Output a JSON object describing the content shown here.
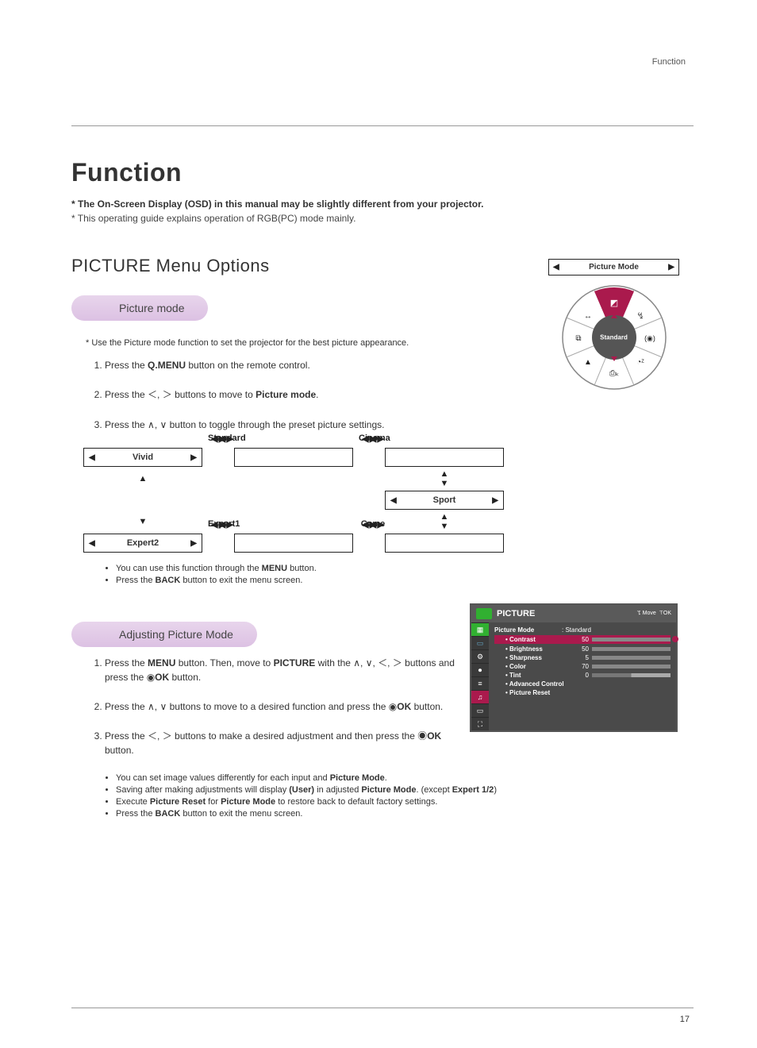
{
  "header": {
    "label": "Function"
  },
  "title": "Function",
  "intro_bold": "* The On-Screen Display (OSD) in this manual may be slightly different from your projector.",
  "intro_note": "* This operating guide explains operation of RGB(PC) mode mainly.",
  "section_title": "PICTURE Menu Options",
  "sub1": {
    "pill": "Picture mode",
    "note": "* Use the Picture mode function to set the projector for the best picture appearance.",
    "steps": {
      "s1a": "Press the ",
      "s1b": "Q.MENU",
      "s1c": " button on the remote control.",
      "s2a": "Press the ",
      "s2b": "＜",
      "s2c": ", ",
      "s2d": "＞",
      "s2e": " buttons to move to ",
      "s2f": "Picture mode",
      "s2g": ".",
      "s3a": "Press the ",
      "s3b": "∧",
      "s3c": ",   ",
      "s3d": "∨",
      "s3e": "  button to toggle through the preset picture settings."
    },
    "modes": {
      "vivid": "Vivid",
      "standard": "Standard",
      "cinema": "Cinema",
      "sport": "Sport",
      "game": "Game",
      "expert1": "Expert1",
      "expert2": "Expert2"
    },
    "bullets": {
      "b1a": "You can use this function through the ",
      "b1b": "MENU",
      "b1c": " button.",
      "b2a": "Press the ",
      "b2b": "BACK",
      "b2c": " button to exit the menu screen."
    }
  },
  "wheel": {
    "title": "Picture Mode",
    "center": "Standard"
  },
  "sub2": {
    "pill": "Adjusting Picture Mode",
    "steps": {
      "s1a": "Press the ",
      "s1b": "MENU",
      "s1c": " button. Then, move to ",
      "s1d": "PICTURE",
      "s1e": " with the ∧, ∨, ＜, ＞ buttons and press the ◉",
      "s1f": "OK",
      "s1g": " button.",
      "s2a": "Press the  ∧, ∨ buttons to move to a desired function and press the ◉",
      "s2b": "OK",
      "s2c": " button.",
      "s3a": "Press the ＜, ＞ buttons to make a desired adjustment and then press the ◉",
      "s3b": "OK",
      "s3c": " button."
    },
    "bullets": {
      "b1a": "You can set image values differently for each input and ",
      "b1b": "Picture Mode",
      "b1c": ".",
      "b2a": "Saving after making adjustments will display ",
      "b2b": "(User)",
      "b2c": " in adjusted ",
      "b2d": "Picture Mode",
      "b2e": ". (except ",
      "b2f": "Expert 1/2",
      "b2g": ")",
      "b3a": "Execute ",
      "b3b": "Picture Reset",
      "b3c": " for ",
      "b3d": "Picture Mode",
      "b3e": " to restore back to default factory settings.",
      "b4a": "Press the ",
      "b4b": "BACK",
      "b4c": " button to exit the menu screen."
    }
  },
  "osd": {
    "title": "PICTURE",
    "nav_move": "ꔂ Move",
    "nav_ok": "ꔉOK",
    "picture_mode_label": "Picture Mode",
    "picture_mode_value": ": Standard",
    "items": [
      {
        "label": "• Contrast",
        "value": "50"
      },
      {
        "label": "• Brightness",
        "value": "50"
      },
      {
        "label": "• Sharpness",
        "value": "5"
      },
      {
        "label": "• Color",
        "value": "70"
      },
      {
        "label": "• Tint",
        "value": "0"
      },
      {
        "label": "• Advanced Control",
        "value": ""
      },
      {
        "label": "• Picture Reset",
        "value": ""
      }
    ]
  },
  "page_number": "17"
}
